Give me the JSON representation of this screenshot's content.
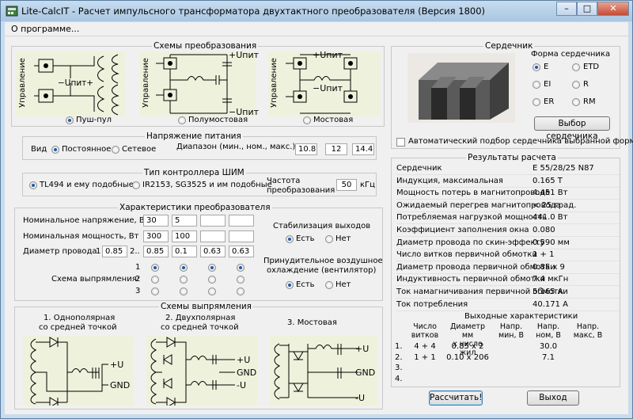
{
  "window": {
    "title": "Lite-CalcIT - Расчет импульсного трансформатора двухтактного преобразователя (Версия 1800)"
  },
  "menu": {
    "about": "О программе..."
  },
  "schemes": {
    "title": "Схемы  преобразования",
    "control_label": "Управление",
    "options": [
      "Пуш-пул",
      "Полумостовая",
      "Мостовая"
    ],
    "selected": 0,
    "upit_pos": "+Uпит",
    "upit_neg": "−Uпит",
    "pp_label": "−Uпит+",
    "mid_label": "−Uпит"
  },
  "power": {
    "title": "Напряжение питания",
    "kind_label": "Вид",
    "options": [
      "Постоянное",
      "Сетевое"
    ],
    "selected": 0,
    "range_label": "Диапазон (мин., ном., макс.), В",
    "range_values": [
      "10.8",
      "12",
      "14.4"
    ]
  },
  "pwm": {
    "title": "Тип контроллера ШИМ",
    "options": [
      "TL494 и ему подобные",
      "IR2153, SG3525 и им подобные"
    ],
    "selected": 0,
    "freq_label1": "Частота",
    "freq_label2": "преобразования",
    "freq_value": "50",
    "freq_unit": "кГц"
  },
  "converter": {
    "title": "Характеристики преобразователя",
    "row_labels": [
      "Номинальное напряжение, В",
      "Номинальная мощность, Вт",
      "Диаметр провода"
    ],
    "voltage": [
      "30",
      "5",
      "",
      ""
    ],
    "power": [
      "300",
      "100",
      "",
      ""
    ],
    "wire_primary": "0.85",
    "wire": [
      "0.85",
      "0.1",
      "0.63",
      "0.63"
    ],
    "wire_sep_1": "1",
    "wire_sep_2": "2..",
    "rect_label": "Схема выпрямления:",
    "rect_rows": [
      "1",
      "2",
      "3"
    ],
    "stab_title": "Стабилизация выходов",
    "stab_options": [
      "Есть",
      "Нет"
    ],
    "stab_selected": 0,
    "cool_title1": "Принудительное воздушное",
    "cool_title2": "охлаждение (вентилятор)",
    "cool_options": [
      "Есть",
      "Нет"
    ],
    "cool_selected": 0
  },
  "rectifiers": {
    "title": "Схемы выпрямления",
    "items": [
      {
        "line1": "1. Однополярная",
        "line2": "со средней точкой"
      },
      {
        "line1": "2. Двухполярная",
        "line2": "со средней точкой"
      },
      {
        "line1": "3. Мостовая",
        "line2": ""
      }
    ],
    "plus_u": "+U",
    "minus_u": "-U",
    "gnd": "GND"
  },
  "core": {
    "title": "Сердечник",
    "shape_title": "Форма сердечника",
    "shapes": [
      "E",
      "ETD",
      "EI",
      "R",
      "ER",
      "RM"
    ],
    "selected": "E",
    "select_button": "Выбор сердечника",
    "auto_label": "Автоматический подбор сердечника выбранной формы"
  },
  "results": {
    "title": "Результаты расчета",
    "rows": [
      {
        "label": "Сердечник",
        "value": "E 55/28/25 N87"
      },
      {
        "label": "Индукция, максимальная",
        "value": "0.165 Т"
      },
      {
        "label": "Мощность потерь в магнитопроводе",
        "value": "4.451 Вт"
      },
      {
        "label": "Ожидаемый перегрев магнитопровода",
        "value": "< 25 град."
      },
      {
        "label": "Потребляемая нагрузкой мощность",
        "value": "441.0 Вт"
      },
      {
        "label": "Коэффициент заполнения окна",
        "value": "0.080"
      },
      {
        "label": "Диаметр провода по скин-эффекту",
        "value": "0.590 мм"
      },
      {
        "label": "Число витков первичной обмотки",
        "value": "1 + 1"
      },
      {
        "label": "Диаметр провода первичной обмотки",
        "value": "0.85 x 9"
      },
      {
        "label": "Индуктивность первичной обмотки",
        "value": "7.4 мкГн"
      },
      {
        "label": "Ток намагничивания первичной обмотки",
        "value": "5.165 А"
      },
      {
        "label": "Ток потребления",
        "value": "40.171 А"
      }
    ],
    "outputs_title": "Выходные характеристики",
    "out_headers": [
      {
        "l1": "Число",
        "l2": "витков"
      },
      {
        "l1": "Диаметр мм",
        "l2": "x число жил"
      },
      {
        "l1": "Напр.",
        "l2": "мин, В"
      },
      {
        "l1": "Напр.",
        "l2": "ном, В"
      },
      {
        "l1": "Напр.",
        "l2": "макс, В"
      }
    ],
    "out_rows": [
      {
        "n": "1.",
        "turns": "4 + 4",
        "diam": "0.85 x 2",
        "vmin": "",
        "vnom": "30.0",
        "vmax": ""
      },
      {
        "n": "2.",
        "turns": "1 + 1",
        "diam": "0.10 x 206",
        "vmin": "",
        "vnom": "7.1",
        "vmax": ""
      },
      {
        "n": "3.",
        "turns": "",
        "diam": "",
        "vmin": "",
        "vnom": "",
        "vmax": ""
      },
      {
        "n": "4.",
        "turns": "",
        "diam": "",
        "vmin": "",
        "vnom": "",
        "vmax": ""
      }
    ]
  },
  "buttons": {
    "calc": "Рассчитать!",
    "exit": "Выход"
  }
}
